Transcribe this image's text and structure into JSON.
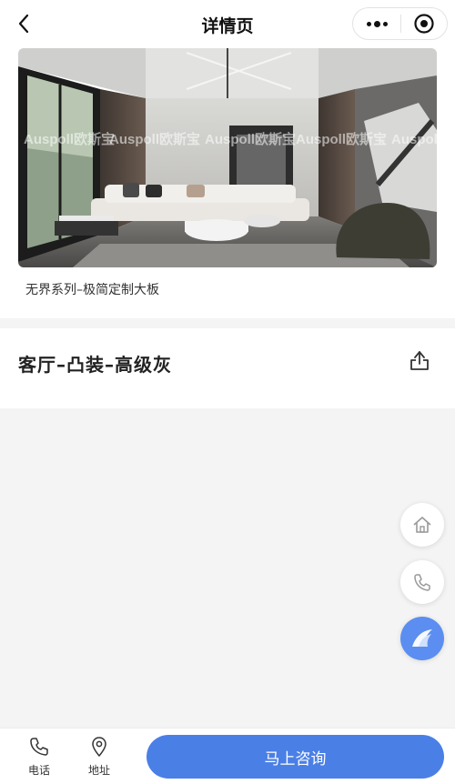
{
  "nav": {
    "title": "详情页"
  },
  "gallery": {
    "caption": "无界系列–极简定制大板",
    "watermark": "Auspoll欧斯宝"
  },
  "product": {
    "title": "客厅–凸装–高级灰"
  },
  "bottombar": {
    "phone_label": "电话",
    "address_label": "地址",
    "consult_label": "马上咨询"
  },
  "colors": {
    "accent": "#4a7fe6",
    "fab_brand": "#5b8ef0"
  }
}
